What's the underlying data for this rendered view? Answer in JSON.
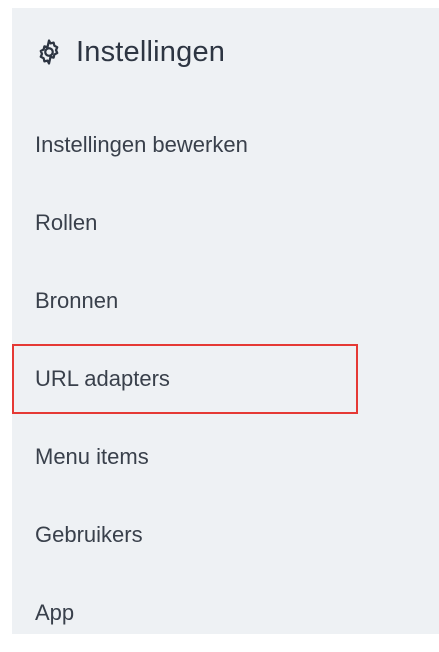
{
  "header": {
    "title": "Instellingen",
    "icon": "gear-icon"
  },
  "menu": {
    "items": [
      {
        "label": "Instellingen bewerken"
      },
      {
        "label": "Rollen"
      },
      {
        "label": "Bronnen"
      },
      {
        "label": "URL adapters",
        "highlighted": true
      },
      {
        "label": "Menu items"
      },
      {
        "label": "Gebruikers"
      },
      {
        "label": "App"
      }
    ]
  },
  "colors": {
    "panel_background": "#eef1f4",
    "text": "#39404b",
    "highlight_border": "#e53935"
  }
}
